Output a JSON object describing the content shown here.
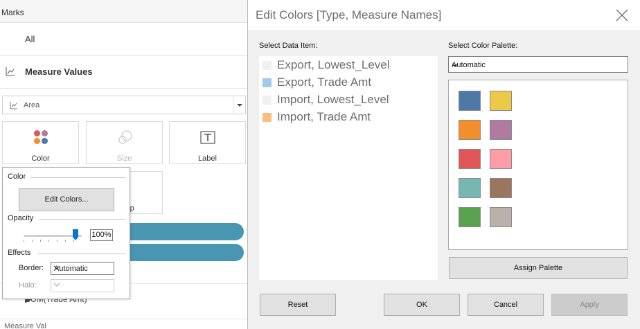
{
  "marks": {
    "header": "Marks",
    "all_label": "All",
    "measure_values_label": "Measure Values",
    "mark_type": "Area",
    "cards": {
      "color": "Color",
      "size": "Size",
      "label": "Label",
      "tooltip_partial": "ip"
    },
    "sum_row_label": "SUM(Trade Amt)",
    "bottom_row_label": "Measure Val"
  },
  "color_popup": {
    "color_section": "Color",
    "edit_colors_button": "Edit Colors...",
    "opacity_section": "Opacity",
    "opacity_value": "100%",
    "opacity_fraction": 1.0,
    "effects_section": "Effects",
    "border_label": "Border:",
    "border_value": "Automatic",
    "halo_label": "Halo:",
    "halo_value": ""
  },
  "dialog": {
    "title": "Edit Colors [Type, Measure Names]",
    "select_data_item_label": "Select Data Item:",
    "select_palette_label": "Select Color Palette:",
    "palette_value": "Automatic",
    "data_items": [
      {
        "label": "Export, Lowest_Level",
        "color": "#f0f0f0"
      },
      {
        "label": "Export, Trade Amt",
        "color": "#9fcbe8"
      },
      {
        "label": "Import, Lowest_Level",
        "color": "#f0f0f0"
      },
      {
        "label": "Import, Trade Amt",
        "color": "#f9be80"
      }
    ],
    "palette_colors": [
      "#4e79a7",
      "#edc948",
      "#f28e2b",
      "#b07aa1",
      "#e15759",
      "#ff9da7",
      "#76b7b2",
      "#9c755f",
      "#59a14f",
      "#bab0ac"
    ],
    "assign_palette_button": "Assign Palette",
    "reset_button": "Reset",
    "ok_button": "OK",
    "cancel_button": "Cancel",
    "apply_button": "Apply"
  },
  "colors": {
    "pill": "#4996b2",
    "slider_thumb": "#0a74d6",
    "color_dots": [
      "#e15759",
      "#b07aa1",
      "#f28e2b",
      "#4e79a7"
    ]
  }
}
